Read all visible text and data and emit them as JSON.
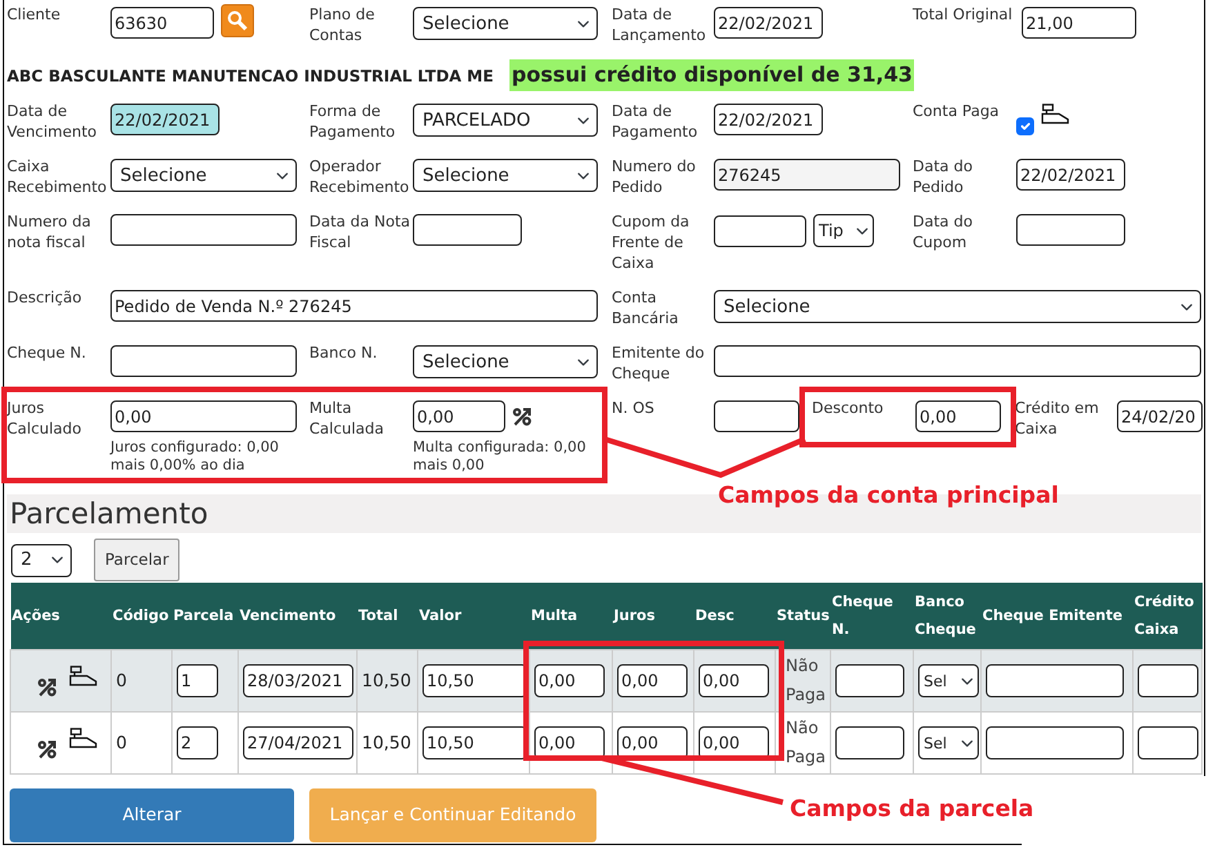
{
  "form": {
    "rows": [
      {
        "kind": "fields",
        "items": [
          {
            "label": "Cliente",
            "controls": [
              {
                "kind": "input",
                "value": "63630"
              },
              {
                "kind": "search"
              }
            ]
          },
          {
            "label": "Plano de Contas",
            "controls": [
              {
                "kind": "select",
                "value": "Selecione"
              }
            ]
          },
          {
            "label": "Data de Lançamento",
            "controls": [
              {
                "kind": "input",
                "value": "22/02/2021"
              }
            ]
          },
          {
            "label": "Total Original",
            "controls": [
              {
                "kind": "input",
                "value": "21,00"
              }
            ]
          }
        ]
      },
      {
        "kind": "banner",
        "company": "ABC BASCULANTE MANUTENCAO INDUSTRIAL LTDA ME",
        "notice": "possui crédito disponível de 31,43"
      },
      {
        "kind": "fields",
        "items": [
          {
            "label": "Data de Vencimento",
            "controls": [
              {
                "kind": "input",
                "value": "22/02/2021",
                "highlighted": true
              }
            ]
          },
          {
            "label": "Forma de Pagamento",
            "controls": [
              {
                "kind": "select",
                "value": "PARCELADO"
              }
            ]
          },
          {
            "label": "Data de Pagamento",
            "controls": [
              {
                "kind": "input",
                "value": "22/02/2021"
              }
            ]
          },
          {
            "label": "Conta Paga",
            "controls": [
              {
                "kind": "checkbox",
                "checked": true
              },
              {
                "kind": "register"
              }
            ]
          }
        ]
      },
      {
        "kind": "fields",
        "items": [
          {
            "label": "Caixa Recebimento",
            "controls": [
              {
                "kind": "select",
                "value": "Selecione"
              }
            ]
          },
          {
            "label": "Operador Recebimento",
            "controls": [
              {
                "kind": "select",
                "value": "Selecione"
              }
            ]
          },
          {
            "label": "Numero do Pedido",
            "controls": [
              {
                "kind": "input",
                "value": "276245",
                "readonly": true
              }
            ]
          },
          {
            "label": "Data do Pedido",
            "controls": [
              {
                "kind": "input",
                "value": "22/02/2021"
              }
            ]
          }
        ]
      },
      {
        "kind": "fields",
        "items": [
          {
            "label": "Numero da nota fiscal",
            "controls": [
              {
                "kind": "input"
              }
            ]
          },
          {
            "label": "Data da Nota Fiscal",
            "controls": [
              {
                "kind": "input"
              }
            ]
          },
          {
            "label": "Cupom da Frente de Caixa",
            "controls": [
              {
                "kind": "input"
              },
              {
                "kind": "select",
                "value": "Tip"
              }
            ]
          },
          {
            "label": "Data do Cupom",
            "controls": [
              {
                "kind": "input"
              }
            ]
          }
        ]
      },
      {
        "kind": "fields",
        "items": [
          {
            "label": "Descrição",
            "controls": [
              {
                "kind": "input",
                "value": "Pedido de Venda N.º 276245"
              }
            ]
          },
          {
            "label": "Conta Bancária",
            "controls": [
              {
                "kind": "select",
                "value": "Selecione"
              }
            ]
          }
        ]
      },
      {
        "kind": "fields",
        "items": [
          {
            "label": "Cheque N.",
            "controls": [
              {
                "kind": "input"
              }
            ]
          },
          {
            "label": "Banco N.",
            "controls": [
              {
                "kind": "select",
                "value": "Selecione"
              }
            ]
          },
          {
            "label": "Emitente do Cheque",
            "controls": [
              {
                "kind": "input"
              }
            ]
          }
        ]
      },
      {
        "kind": "fields",
        "items": [
          {
            "label": "Juros Calculado",
            "controls": [
              {
                "kind": "input",
                "value": "0,00"
              }
            ],
            "help": "Juros configurado: 0,00 mais 0,00% ao dia"
          },
          {
            "label": "Multa Calculada",
            "controls": [
              {
                "kind": "input",
                "value": "0,00"
              },
              {
                "kind": "percent"
              }
            ],
            "help": "Multa configurada: 0,00 mais 0,00"
          },
          {
            "label": "N. OS",
            "controls": [
              {
                "kind": "input"
              }
            ]
          },
          {
            "label": "Desconto",
            "controls": [
              {
                "kind": "input",
                "value": "0,00"
              }
            ]
          },
          {
            "label": "Crédito em Caixa",
            "controls": [
              {
                "kind": "input",
                "value": "24/02/20"
              }
            ]
          }
        ]
      }
    ]
  },
  "installments": {
    "title": "Parcelamento",
    "count": "2",
    "button": "Parcelar",
    "columns": [
      "Ações",
      "Código",
      "Parcela",
      "Vencimento",
      "Total",
      "Valor",
      "Multa",
      "Juros",
      "Desc",
      "Status",
      "Cheque N.",
      "Banco Cheque",
      "Cheque Emitente",
      "Crédito Caixa"
    ],
    "rows": [
      {
        "code": "0",
        "number": "1",
        "due": "28/03/2021",
        "total": "10,50",
        "value": "10,50",
        "fine": "0,00",
        "interest": "0,00",
        "discount": "0,00",
        "status": "Não Paga",
        "bank": "Sel"
      },
      {
        "code": "0",
        "number": "2",
        "due": "27/04/2021",
        "total": "10,50",
        "value": "10,50",
        "fine": "0,00",
        "interest": "0,00",
        "discount": "0,00",
        "status": "Não Paga",
        "bank": "Sel"
      }
    ]
  },
  "actions": [
    {
      "label": "Alterar",
      "kind": "primary"
    },
    {
      "label": "Lançar e Continuar Editando",
      "kind": "warning"
    }
  ],
  "annotations": [
    {
      "text": "Campos da conta principal"
    },
    {
      "text": "Campos da parcela"
    }
  ]
}
